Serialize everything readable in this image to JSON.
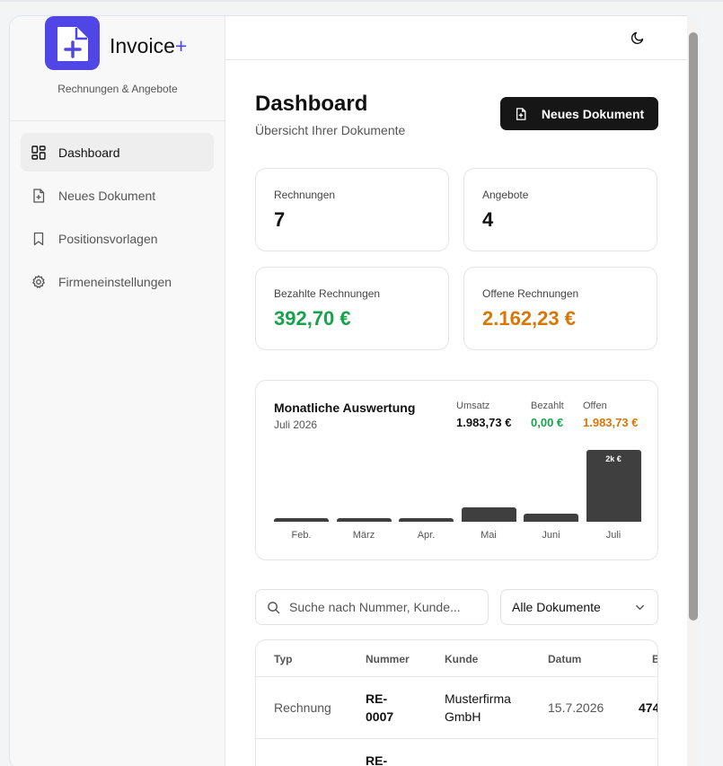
{
  "brand": {
    "name": "Invoice",
    "plus": "+",
    "tagline": "Rechnungen & Angebote"
  },
  "nav": {
    "items": [
      {
        "label": "Dashboard",
        "icon": "dashboard-icon",
        "active": true
      },
      {
        "label": "Neues Dokument",
        "icon": "file-plus-icon"
      },
      {
        "label": "Positionsvorlagen",
        "icon": "bookmark-icon"
      },
      {
        "label": "Firmeneinstellungen",
        "icon": "gear-icon"
      }
    ]
  },
  "header": {
    "theme_icon": "moon-icon"
  },
  "page": {
    "title": "Dashboard",
    "subtitle": "Übersicht Ihrer Dokumente",
    "new_button": "Neues Dokument"
  },
  "stats": [
    {
      "label": "Rechnungen",
      "value": "7"
    },
    {
      "label": "Angebote",
      "value": "4"
    },
    {
      "label": "Bezahlte Rechnungen",
      "value": "392,70 €",
      "color": "#16a34a"
    },
    {
      "label": "Offene Rechnungen",
      "value": "2.162,23 €",
      "color": "#d97706"
    }
  ],
  "monthly": {
    "title": "Monatliche Auswertung",
    "subtitle": "Juli 2026",
    "umsatz_label": "Umsatz",
    "umsatz_value": "1.983,73 €",
    "bezahlt_label": "Bezahlt",
    "bezahlt_value": "0,00 €",
    "offen_label": "Offen",
    "offen_value": "1.983,73 €"
  },
  "chart_data": {
    "type": "bar",
    "categories": [
      "Feb.",
      "März",
      "Apr.",
      "Mai",
      "Juni",
      "Juli"
    ],
    "values": [
      100,
      100,
      100,
      390,
      220,
      1983.73
    ],
    "ylim": [
      0,
      1983.73
    ],
    "annotations": [
      {
        "category": "Juli",
        "text": "2k €"
      }
    ]
  },
  "filters": {
    "search_placeholder": "Suche nach Nummer, Kunde...",
    "select_value": "Alle Dokumente"
  },
  "table": {
    "columns": [
      "Typ",
      "Nummer",
      "Kunde",
      "Datum",
      "B"
    ],
    "rows": [
      {
        "typ": "Rechnung",
        "nummer_1": "RE-",
        "nummer_2": "0007",
        "kunde_1": "Musterfirma",
        "kunde_2": "GmbH",
        "datum": "15.7.2026",
        "betrag": "474"
      },
      {
        "nummer_1": "RE-"
      }
    ]
  }
}
